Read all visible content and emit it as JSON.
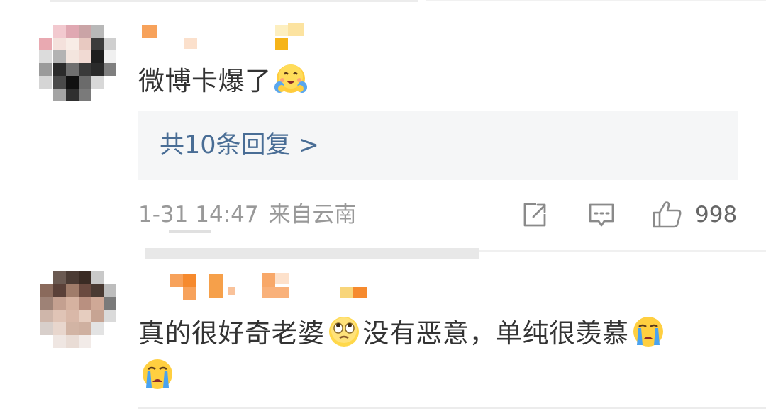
{
  "comments": [
    {
      "text_before_emoji": "微博卡爆了",
      "emoji": "hugging-emoji",
      "reply_link": "共10条回复 >",
      "meta": {
        "date": "1-31",
        "time": "14:47",
        "location": "来自云南"
      },
      "like_count": "998"
    },
    {
      "text_part1": "真的很好奇老婆",
      "emoji1": "eye-roll-emoji",
      "text_part2": "没有恶意，单纯很羡慕",
      "emoji2": "crying-emoji",
      "emoji3": "crying-emoji"
    }
  ],
  "colors": {
    "link": "#496d95",
    "meta_text": "#999999",
    "reply_bg": "#f5f6f7",
    "name_mosaic": "#f7a25b"
  }
}
